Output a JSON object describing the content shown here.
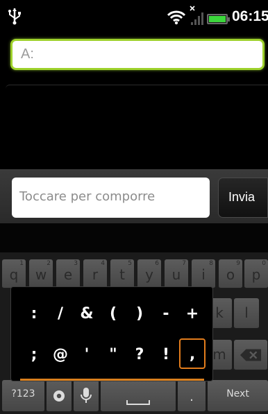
{
  "status_bar": {
    "time": "06:15",
    "icons": [
      "usb-icon",
      "wifi-icon",
      "no-signal-icon",
      "battery-icon"
    ],
    "battery_color": "#3cd63c"
  },
  "to_field": {
    "label": "A:"
  },
  "compose": {
    "placeholder": "Toccare per comporre",
    "send_label": "Invia"
  },
  "keyboard": {
    "row1": [
      {
        "label": "q",
        "hint": "1"
      },
      {
        "label": "w",
        "hint": "2"
      },
      {
        "label": "e",
        "hint": "3"
      },
      {
        "label": "r",
        "hint": "4"
      },
      {
        "label": "t",
        "hint": "5"
      },
      {
        "label": "y",
        "hint": "6"
      },
      {
        "label": "u",
        "hint": "7"
      },
      {
        "label": "i",
        "hint": "8"
      },
      {
        "label": "o",
        "hint": "9"
      },
      {
        "label": "p",
        "hint": "0"
      }
    ],
    "row2_visible": [
      "k",
      "l"
    ],
    "row3_visible": [
      "m"
    ],
    "row4": {
      "symbols_key": "?123",
      "space_key": "",
      "period_key": ".",
      "next_key": "Next"
    }
  },
  "symbol_popup": {
    "row1": [
      ":",
      "/",
      "&",
      "(",
      ")",
      "-",
      "+"
    ],
    "row2": [
      ";",
      "@",
      "'",
      "\"",
      "?",
      "!",
      ","
    ],
    "highlight_color": "#e37d1c"
  }
}
